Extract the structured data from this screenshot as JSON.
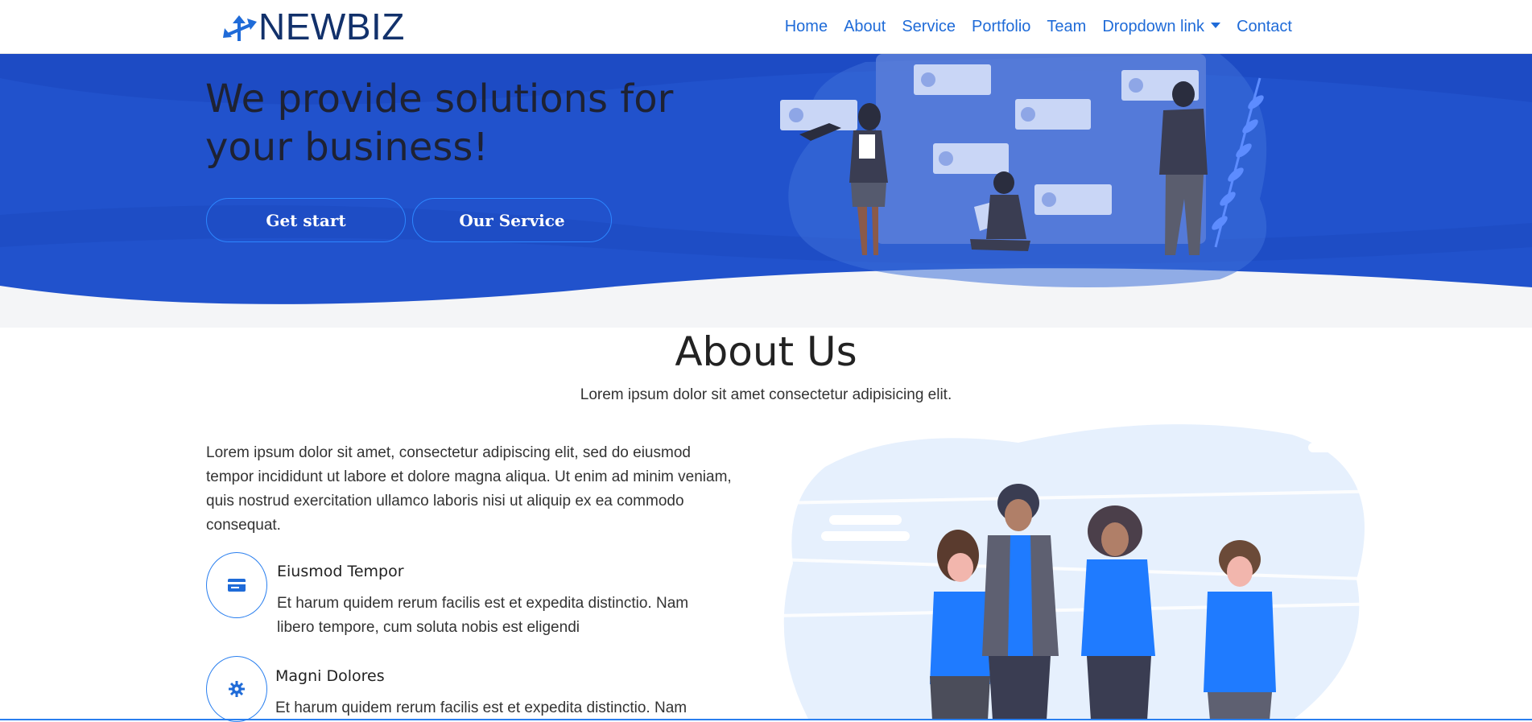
{
  "brand": {
    "name": "NEWBIZ",
    "icon": "arrows-logo-icon"
  },
  "nav": {
    "items": [
      "Home",
      "About",
      "Service",
      "Portfolio",
      "Team",
      "Dropdown link",
      "Contact"
    ]
  },
  "hero": {
    "title": "We provide solutions for your business!",
    "buttons": {
      "get_start": "Get start",
      "our_service": "Our Service"
    }
  },
  "about": {
    "title": "About Us",
    "subtitle": "Lorem ipsum dolor sit amet consectetur adipisicing elit.",
    "paragraph": "Lorem ipsum dolor sit amet, consectetur adipiscing elit, sed do eiusmod tempor incididunt ut labore et dolore magna aliqua. Ut enim ad minim veniam, quis nostrud exercitation ullamco laboris nisi ut aliquip ex ea commodo consequat.",
    "features": [
      {
        "title": "Eiusmod Tempor",
        "desc": "Et harum quidem rerum facilis est et expedita distinctio. Nam libero tempore, cum soluta nobis est eligendi",
        "icon": "credit-card-icon"
      },
      {
        "title": "Magni Dolores",
        "desc": "Et harum quidem rerum facilis est et expedita distinctio. Nam",
        "icon": "gear-icon"
      }
    ]
  },
  "colors": {
    "primary": "#1f6bd8",
    "hero_blue": "#1f4fc9",
    "brand_navy": "#12316b"
  }
}
